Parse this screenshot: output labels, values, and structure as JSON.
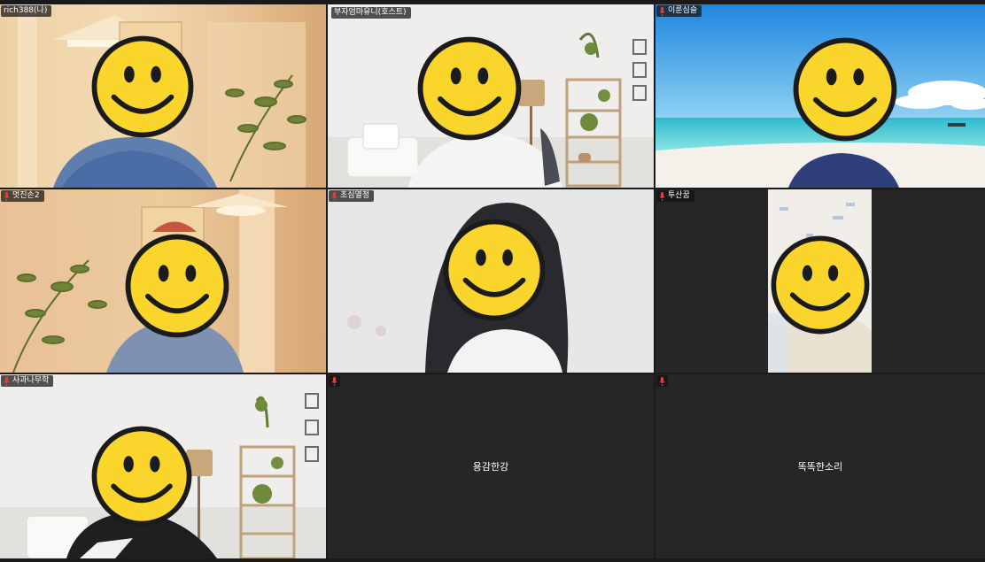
{
  "participants": [
    {
      "name": "rich388(나)",
      "scene": "warm-room",
      "video": true,
      "active": false
    },
    {
      "name": "부자엄마유니(호스트)",
      "scene": "white-room",
      "video": true,
      "active": true
    },
    {
      "name": "이룬심슬",
      "scene": "beach",
      "video": true,
      "active": false
    },
    {
      "name": "멋진손2",
      "scene": "warm-room",
      "video": true,
      "active": false
    },
    {
      "name": "초심열정",
      "scene": "grey-wall",
      "video": true,
      "active": false
    },
    {
      "name": "투산꿈",
      "scene": "portrait-crop",
      "video": true,
      "active": false
    },
    {
      "name": "사과나무학",
      "scene": "white-room",
      "video": true,
      "active": false
    },
    {
      "name": "",
      "center_name": "용감한강",
      "video": false,
      "active": false
    },
    {
      "name": "",
      "center_name": "똑똑한소리",
      "video": false,
      "active": false
    }
  ],
  "colors": {
    "active_border": "#23d160",
    "mic_muted": "#e0413a",
    "label_bg": "#141414",
    "tile_bg": "#262626"
  },
  "icons": {
    "mic": "mic-muted-icon",
    "face_cover": "smiley-face-icon"
  }
}
